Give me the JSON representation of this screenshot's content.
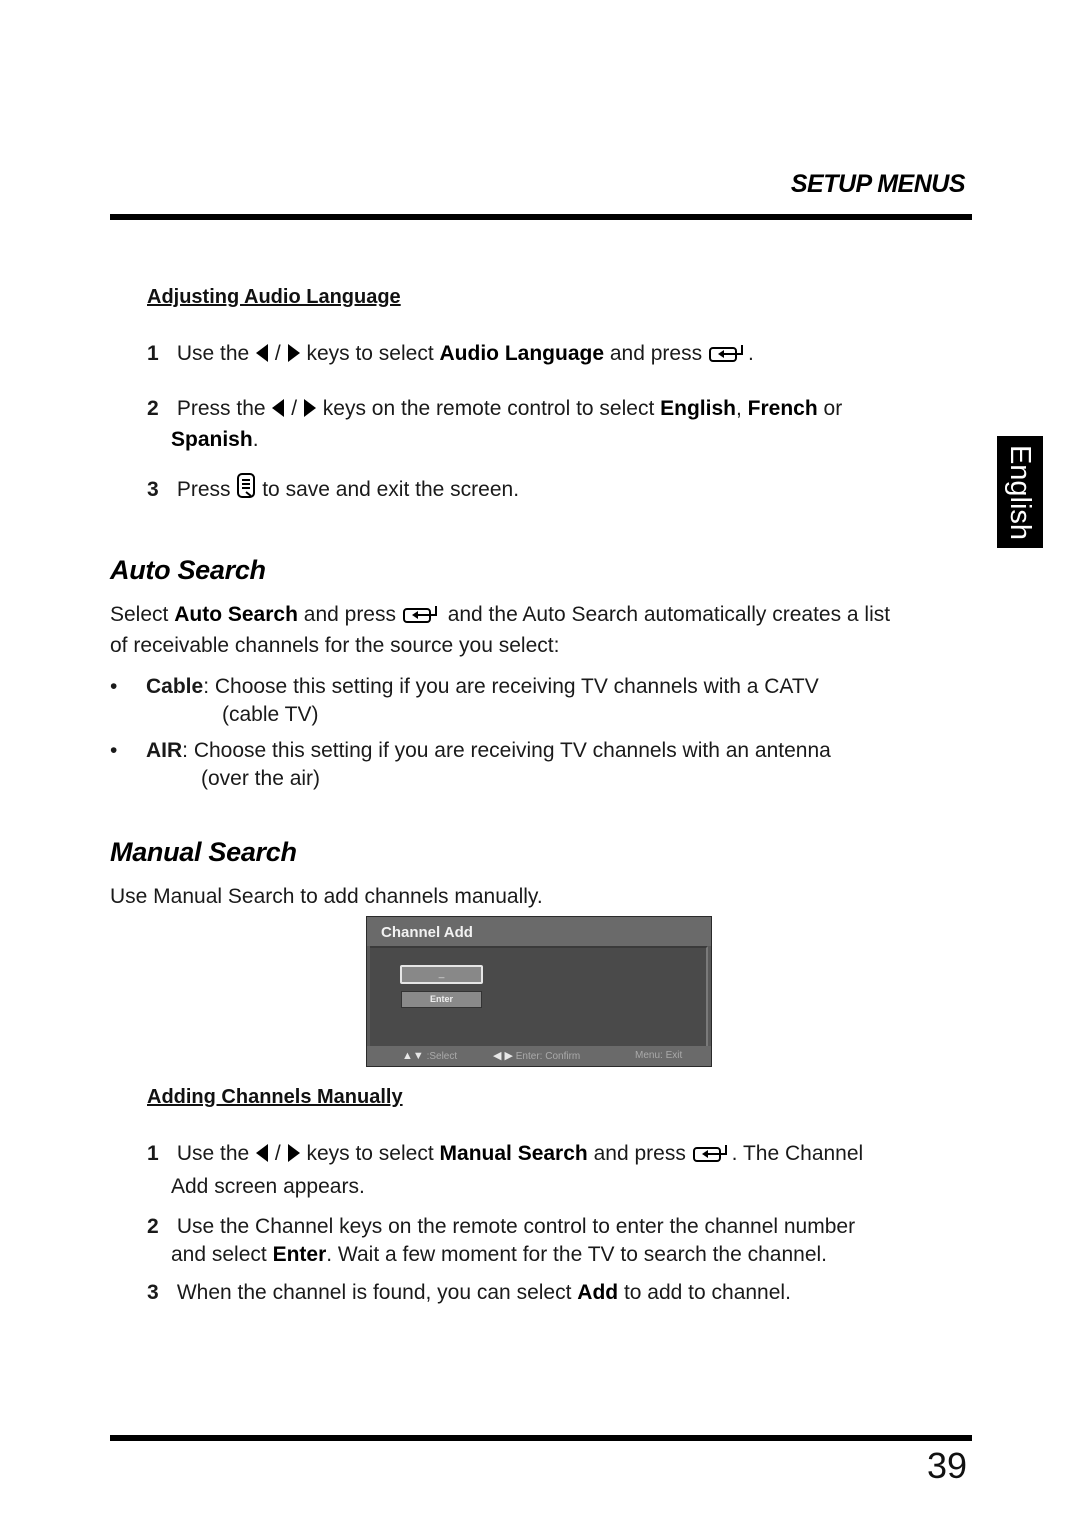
{
  "header": {
    "section_label": "SETUP MENUS"
  },
  "side_tab": {
    "label": "English"
  },
  "audio_language": {
    "subheading": "Adjusting Audio Language",
    "steps": [
      {
        "num": "1",
        "t1": "Use the",
        "t2": "keys to select",
        "bold1": "Audio Language",
        "t3": "and press",
        "t4": "."
      },
      {
        "num": "2",
        "t1": "Press the",
        "t2": "keys on the remote control to select",
        "bold1": "English",
        "sep1": ",",
        "bold2": "French",
        "t3": "or",
        "bold3": "Spanish",
        "t4": "."
      },
      {
        "num": "3",
        "t1": "Press",
        "t2": "to save and exit the screen."
      }
    ]
  },
  "auto_search": {
    "title": "Auto Search",
    "intro": {
      "t1": "Select",
      "bold1": "Auto Search",
      "t2": "and press",
      "t3": "and the Auto Search automatically creates a list",
      "t4": "of receivable channels for the source you select:"
    },
    "bullets": [
      {
        "bullet": "•",
        "term": "Cable",
        "line1": ": Choose this setting if you are receiving TV channels with a CATV",
        "line2": "(cable TV)"
      },
      {
        "bullet": "•",
        "term": "AIR",
        "line1": ": Choose this setting if you are receiving TV channels with an antenna",
        "line2": "(over the air)"
      }
    ]
  },
  "manual_search": {
    "title": "Manual Search",
    "intro": "Use Manual Search to add channels manually.",
    "tv_screen": {
      "title": "Channel Add",
      "channel_input_value": "_",
      "enter_button": "Enter",
      "footer": [
        {
          "glyph": "▲▼",
          "text": ":Select"
        },
        {
          "glyph": "◀ ▶",
          "text": "Enter: Confirm"
        },
        {
          "glyph": "",
          "text": "Menu: Exit"
        }
      ]
    },
    "subheading": "Adding Channels Manually",
    "steps": [
      {
        "num": "1",
        "t1": "Use the",
        "t2": "keys to select",
        "bold1": "Manual Search",
        "t3": "and press",
        "t4": ". The Channel",
        "t5": "Add screen appears."
      },
      {
        "num": "2",
        "t1": "Use the Channel keys on the remote control to enter the channel number",
        "t2": "and select",
        "bold1": "Enter",
        "t3": ". Wait a few moment for the TV to search the channel."
      },
      {
        "num": "3",
        "t1": "When the channel is found, you can select",
        "bold1": "Add",
        "t2": "to add to channel."
      }
    ]
  },
  "footer": {
    "page_number": "39"
  },
  "icons": {
    "left_arrow": "left-arrow-key-icon",
    "right_arrow": "right-arrow-key-icon",
    "enter_key": "enter-key-icon",
    "menu_key": "menu-key-icon",
    "key_separator": "/"
  }
}
